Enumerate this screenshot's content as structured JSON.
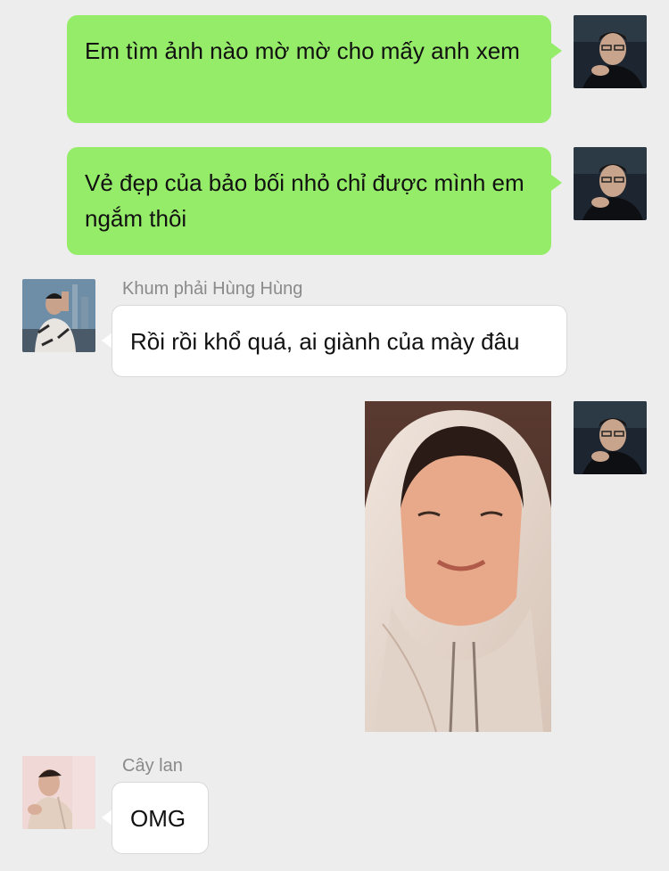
{
  "messages": [
    {
      "direction": "outgoing",
      "type": "text",
      "text": "Em tìm ảnh nào mờ mờ cho mấy anh xem",
      "avatar_icon": "user-avatar-icon"
    },
    {
      "direction": "outgoing",
      "type": "text",
      "text": "Vẻ đẹp của bảo bối nhỏ chỉ được mình em ngắm thôi",
      "avatar_icon": "user-avatar-icon"
    },
    {
      "direction": "incoming",
      "type": "text",
      "sender": "Khum phải Hùng Hùng",
      "text": "Rồi rồi khổ quá, ai giành của mày đâu",
      "avatar_icon": "contact-avatar-icon"
    },
    {
      "direction": "outgoing",
      "type": "image",
      "image_icon": "photo-of-smiling-man-in-hoodie",
      "avatar_icon": "user-avatar-icon"
    },
    {
      "direction": "incoming",
      "type": "text",
      "sender": "Cây lan",
      "text": "OMG",
      "avatar_icon": "contact-avatar-icon"
    }
  ],
  "colors": {
    "background": "#ededed",
    "outgoing_bubble": "#95ec69",
    "incoming_bubble": "#ffffff",
    "sender_name": "#8a8a8a"
  }
}
